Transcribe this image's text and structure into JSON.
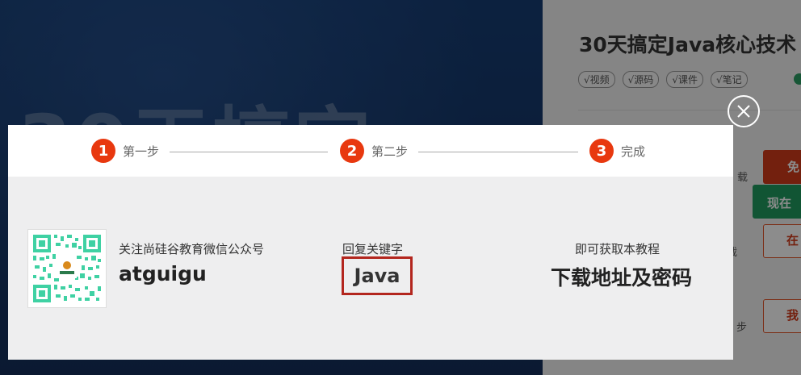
{
  "background": {
    "hero_text": "30天搞定",
    "course_title": "30天搞定Java核心技术",
    "tags": [
      "√视频",
      "√源码",
      "√课件",
      "√笔记"
    ],
    "side_fragments": [
      "载",
      "载",
      "步"
    ],
    "side_buttons": [
      "免",
      "现在",
      "在",
      "我"
    ]
  },
  "modal": {
    "steps": [
      {
        "num": "1",
        "label": "第一步"
      },
      {
        "num": "2",
        "label": "第二步"
      },
      {
        "num": "3",
        "label": "完成"
      }
    ],
    "follow": {
      "text": "关注尚硅谷教育微信公众号",
      "account": "atguigu"
    },
    "reply": {
      "text": "回复关键字",
      "keyword": "Java"
    },
    "result": {
      "text": "即可获取本教程",
      "big": "下载地址及密码"
    }
  },
  "colors": {
    "step_accent": "#e8380f",
    "keyword_border": "#b3261e",
    "qr_green": "#3fd1a3"
  },
  "icons": {
    "close": "close-icon",
    "qr": "qr-code-icon"
  }
}
